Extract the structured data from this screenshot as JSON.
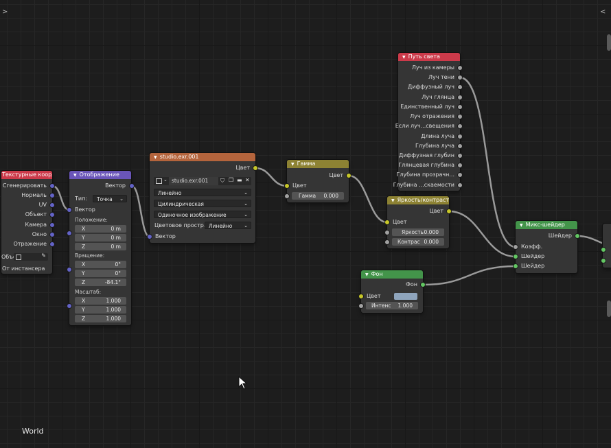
{
  "editor": {
    "label": "World",
    "left_toggle": ">",
    "right_toggle": "<"
  },
  "colors": {
    "header_input": "#cc3a4a",
    "header_vector": "#6a55b9",
    "header_texture": "#b4643c",
    "header_color": "#8d8233",
    "header_shader": "#43944a",
    "socket_vector": "#6363c7",
    "socket_color": "#c7c729",
    "socket_float": "#a1a1a1",
    "socket_shader": "#63c763"
  },
  "nodes": {
    "texcoord": {
      "title": "Текстурные коорд...",
      "outputs": [
        "Сгенерировать",
        "Нормаль",
        "UV",
        "Объект",
        "Камера",
        "Окно",
        "Отражение"
      ],
      "object_label": "Объе...",
      "from_instancer": "От инстансера"
    },
    "mapping": {
      "title": "Отображение",
      "output": "Вектор",
      "type_label": "Тип:",
      "type_value": "Точка",
      "vector_label": "Вектор",
      "location_label": "Положение:",
      "location": [
        {
          "a": "X",
          "v": "0 m"
        },
        {
          "a": "Y",
          "v": "0 m"
        },
        {
          "a": "Z",
          "v": "0 m"
        }
      ],
      "rotation_label": "Вращение:",
      "rotation": [
        {
          "a": "X",
          "v": "0°"
        },
        {
          "a": "Y",
          "v": "0°"
        },
        {
          "a": "Z",
          "v": "-84.1°"
        }
      ],
      "scale_label": "Масштаб:",
      "scale": [
        {
          "a": "X",
          "v": "1.000"
        },
        {
          "a": "Y",
          "v": "1.000"
        },
        {
          "a": "Z",
          "v": "1.000"
        }
      ]
    },
    "envtex": {
      "title": "studio.exr.001",
      "output": "Цвет",
      "image_name": "studio.exr.001",
      "interpolation": "Линейно",
      "projection": "Цилиндрическая",
      "source": "Одиночное изображение",
      "colorspace_label": "Цветовое простр...",
      "colorspace_value": "Линейно",
      "vector_label": "Вектор"
    },
    "gamma": {
      "title": "Гамма",
      "output": "Цвет",
      "input": "Цвет",
      "gamma_label": "Гамма",
      "gamma_value": "0.000"
    },
    "brightcontrast": {
      "title": "Яркость/контраст",
      "output": "Цвет",
      "input": "Цвет",
      "bright_label": "Яркость",
      "bright_value": "0.000",
      "contrast_label": "Контрас",
      "contrast_value": "0.000"
    },
    "lightpath": {
      "title": "Путь света",
      "outputs": [
        "Луч из камеры",
        "Луч тени",
        "Диффузный луч",
        "Луч глянца",
        "Единственный луч",
        "Луч отражения",
        "Если луч...свещения",
        "Длина луча",
        "Глубина луча",
        "Диффузная глубин",
        "Глянцевая глубина",
        "Глубина прозрачн...",
        "Глубина ...скаемости"
      ]
    },
    "background": {
      "title": "Фон",
      "output": "Фон",
      "color_label": "Цвет",
      "color_value": "#8fa5bd",
      "strength_label": "Интенс",
      "strength_value": "1.000"
    },
    "mixshader": {
      "title": "Микс-шейдер",
      "output": "Шейдер",
      "inputs": [
        "Коэфф.",
        "Шейдер",
        "Шейдер"
      ]
    }
  }
}
